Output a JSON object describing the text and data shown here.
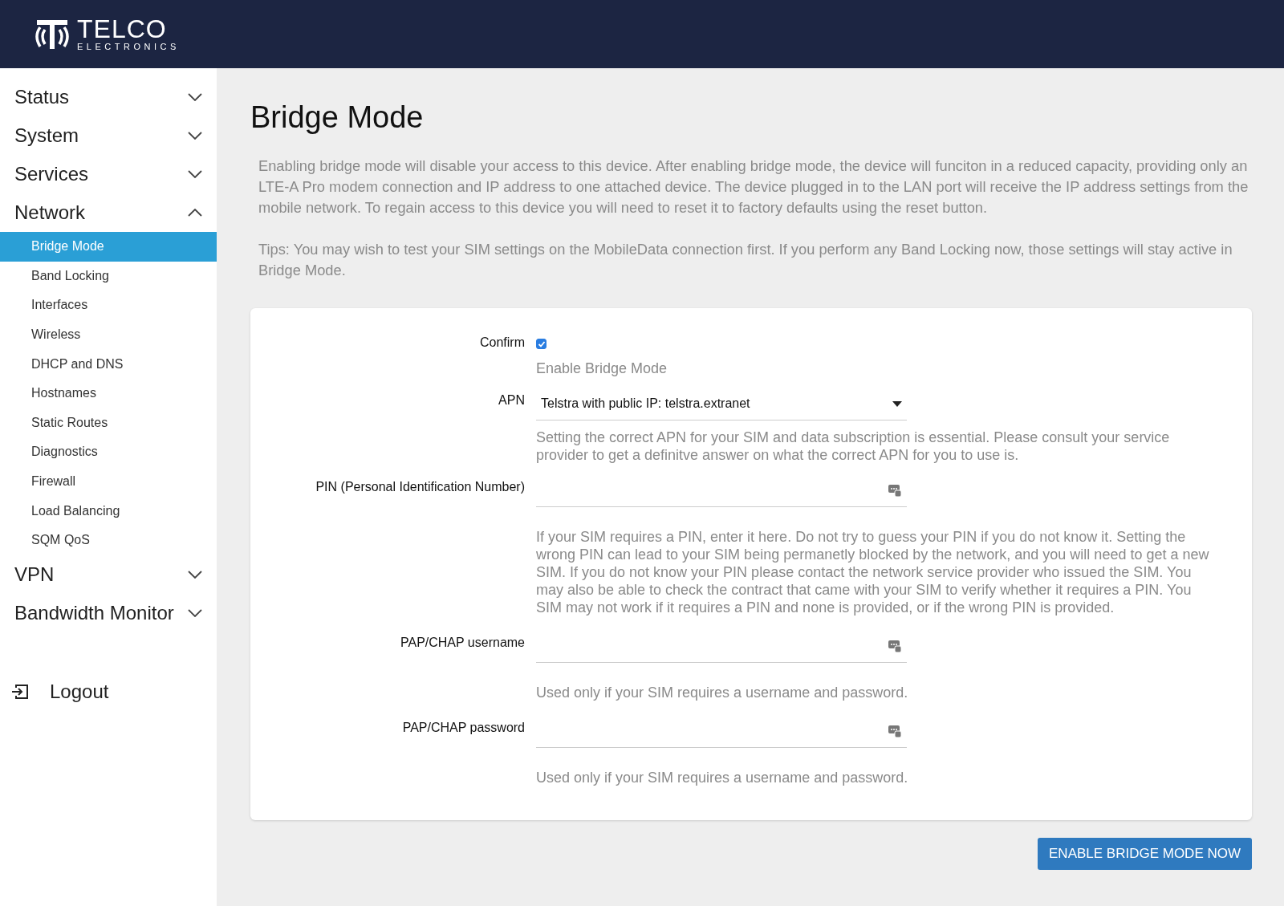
{
  "header": {
    "logo_title": "TELCO",
    "logo_subtitle": "ELECTRONICS"
  },
  "sidebar": {
    "groups": [
      {
        "label": "Status",
        "expanded": false
      },
      {
        "label": "System",
        "expanded": false
      },
      {
        "label": "Services",
        "expanded": false
      },
      {
        "label": "Network",
        "expanded": true,
        "children": [
          {
            "label": "Bridge Mode",
            "selected": true
          },
          {
            "label": "Band Locking",
            "selected": false
          },
          {
            "label": "Interfaces",
            "selected": false
          },
          {
            "label": "Wireless",
            "selected": false
          },
          {
            "label": "DHCP and DNS",
            "selected": false
          },
          {
            "label": "Hostnames",
            "selected": false
          },
          {
            "label": "Static Routes",
            "selected": false
          },
          {
            "label": "Diagnostics",
            "selected": false
          },
          {
            "label": "Firewall",
            "selected": false
          },
          {
            "label": "Load Balancing",
            "selected": false
          },
          {
            "label": "SQM QoS",
            "selected": false
          }
        ]
      },
      {
        "label": "VPN",
        "expanded": false
      },
      {
        "label": "Bandwidth Monitor",
        "expanded": false
      }
    ],
    "logout": "Logout"
  },
  "page": {
    "title": "Bridge Mode",
    "description": "Enabling bridge mode will disable your access to this device. After enabling bridge mode, the device will funciton in a reduced capacity, providing only an LTE-A Pro modem connection and IP address to one attached device. The device plugged in to the LAN port will receive the IP address settings from the mobile network. To regain access to this device you will need to reset it to factory defaults using the reset button.",
    "tips": "Tips: You may wish to test your SIM settings on the MobileData connection first. If you perform any Band Locking now, those settings will stay active in Bridge Mode."
  },
  "form": [
    {
      "kind": "checkbox",
      "label": "Confirm",
      "checked": true,
      "help": "Enable Bridge Mode"
    },
    {
      "kind": "select",
      "label": "APN",
      "value": "Telstra with public IP: telstra.extranet",
      "help": "Setting the correct APN for your SIM and data subscription is essential. Please consult your service provider to get a definitve answer on what the correct APN for you to use is."
    },
    {
      "kind": "text",
      "label": "PIN (Personal Identification Number)",
      "help": "If your SIM requires a PIN, enter it here. Do not try to guess your PIN if you do not know it. Setting the wrong PIN can lead to your SIM being permanetly blocked by the network, and you will need to get a new SIM. If you do not know your PIN please contact the network service provider who issued the SIM. You may also be able to check the contract that came with your SIM to verify whether it requires a PIN. You SIM may not work if it requires a PIN and none is provided, or if the wrong PIN is provided."
    },
    {
      "kind": "text",
      "label": "PAP/CHAP username",
      "help": "Used only if your SIM requires a username and password."
    },
    {
      "kind": "text",
      "label": "PAP/CHAP password",
      "help": "Used only if your SIM requires a username and password."
    }
  ],
  "submit": "ENABLE BRIDGE MODE NOW"
}
